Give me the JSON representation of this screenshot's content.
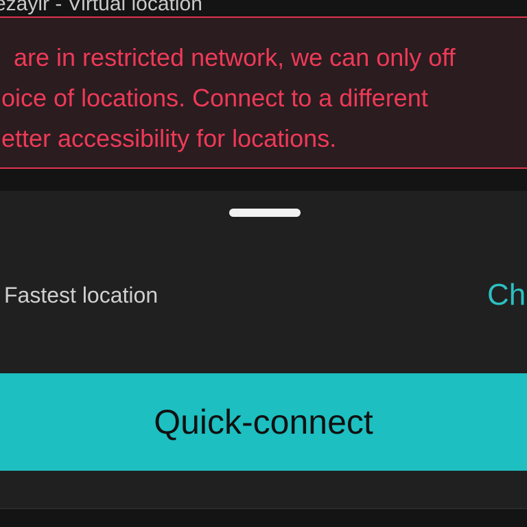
{
  "header": {
    "title": "ezayir - Virtual location"
  },
  "warning": {
    "lines": [
      " are in restricted network, we can only off",
      "oice of locations. Connect to a different",
      "etter accessibility for locations."
    ]
  },
  "location": {
    "label": "Fastest location",
    "change_label": "Ch"
  },
  "actions": {
    "quick_connect_label": "Quick-connect"
  },
  "colors": {
    "warning_text": "#ee3a57",
    "warning_border": "#e2354f",
    "accent": "#1dbfc1",
    "sheet_background": "#202020"
  }
}
